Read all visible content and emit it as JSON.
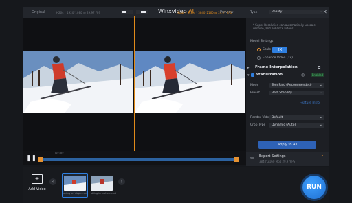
{
  "app": {
    "title_main": "Winxvideo",
    "title_ai": "AI"
  },
  "preview": {
    "original_label": "Original",
    "original_meta": "H264 * 1920*1080 @ 29.97 FPS",
    "enhanced_label": "Stab + Scale * 3840*2160 @ 29.97 FPS",
    "preview_label": "Preview"
  },
  "timeline": {
    "current_time": "00:00:"
  },
  "panel": {
    "type_label": "Type",
    "type_value": "Reality",
    "desc": "* Super Resolution can automatically upscale, denoise, and enhance videos.",
    "model_settings": "Model Settings",
    "scale_label": "Scale",
    "scale_value": "2X",
    "enhance_label": "Enhance Video (1x)",
    "frame_interp": "Frame Interpolation",
    "stabilization": "Stabilization",
    "enabled": "Enabled",
    "mode_label": "Mode",
    "mode_value": "Tom Palo (Recommended)",
    "preset_label": "Preset",
    "preset_value": "Best Stability",
    "feature_link": "Feature Intro",
    "render_label": "Render Video",
    "render_value": "Default",
    "crop_label": "Crop Type",
    "crop_value": "Dynamic (Auto)",
    "apply": "Apply to All"
  },
  "export": {
    "title": "Export Settings",
    "meta": "3840*2160 Mp4 29.97FPS"
  },
  "bottom": {
    "add_video": "Add Video",
    "thumb1": "skiing on slope.mp4",
    "thumb2": "skiing in motion.mp4",
    "run": "RUN"
  }
}
